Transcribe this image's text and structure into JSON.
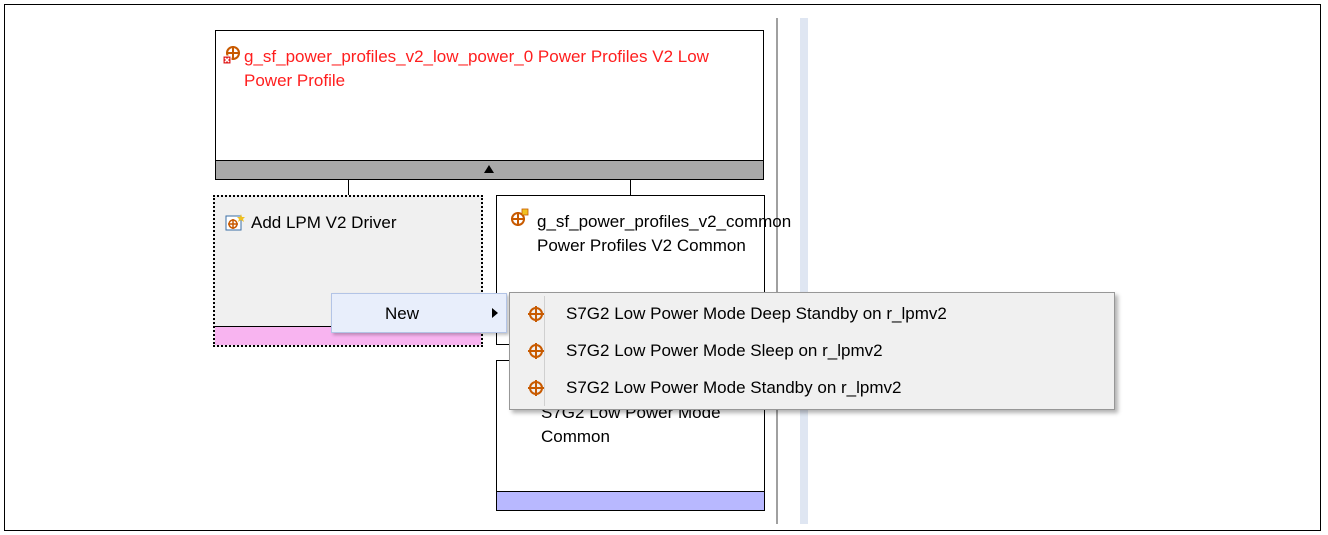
{
  "canvas": {
    "main_component": {
      "label": "g_sf_power_profiles_v2_low_power_0 Power Profiles V2 Low Power Profile",
      "icon": "component-error-icon",
      "color": "#ff1e1e"
    },
    "add_lpm_driver": {
      "label": "Add LPM V2 Driver",
      "icon": "add-driver-icon"
    },
    "common_component": {
      "label": "g_sf_power_profiles_v2_common Power Profiles V2 Common",
      "icon": "component-icon"
    },
    "lpm_common_component": {
      "label": "S7G2 Low Power Mode Common"
    }
  },
  "context_menu": {
    "new_label": "New",
    "submenu": [
      {
        "label": "S7G2 Low Power Mode Deep Standby on r_lpmv2",
        "icon": "module-icon"
      },
      {
        "label": "S7G2 Low Power Mode Sleep on r_lpmv2",
        "icon": "module-icon"
      },
      {
        "label": "S7G2 Low Power Mode Standby on r_lpmv2",
        "icon": "module-icon"
      }
    ]
  }
}
